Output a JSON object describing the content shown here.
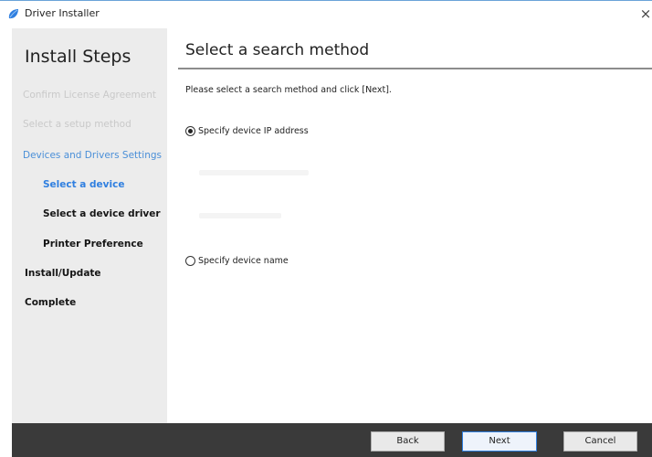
{
  "window": {
    "title": "Driver Installer",
    "close_glyph": "×",
    "icon": "app-logo-icon"
  },
  "sidebar": {
    "title": "Install Steps",
    "steps": [
      {
        "label": "Confirm License Agreement",
        "state": "faded"
      },
      {
        "label": "Select a setup method",
        "state": "faded"
      },
      {
        "label": "Devices and Drivers Settings",
        "state": "section"
      },
      {
        "label": "Select a device",
        "state": "current"
      },
      {
        "label": "Select a device driver",
        "state": "bold"
      },
      {
        "label": "Printer Preference",
        "state": "bold"
      },
      {
        "label": "Install/Update",
        "state": "bold"
      },
      {
        "label": "Complete",
        "state": "bold"
      }
    ]
  },
  "main": {
    "title": "Select a search method",
    "instruction": "Please select a search method and click [Next].",
    "options": [
      {
        "label": "Specify device IP address",
        "checked": true
      },
      {
        "label": "Specify device name",
        "checked": false
      }
    ]
  },
  "footer": {
    "back_label": "Back",
    "next_label": "Next",
    "cancel_label": "Cancel"
  },
  "colors": {
    "accent": "#2f7fe0",
    "footer_bg": "#3a3a3a",
    "sidebar_bg": "#ececec"
  }
}
